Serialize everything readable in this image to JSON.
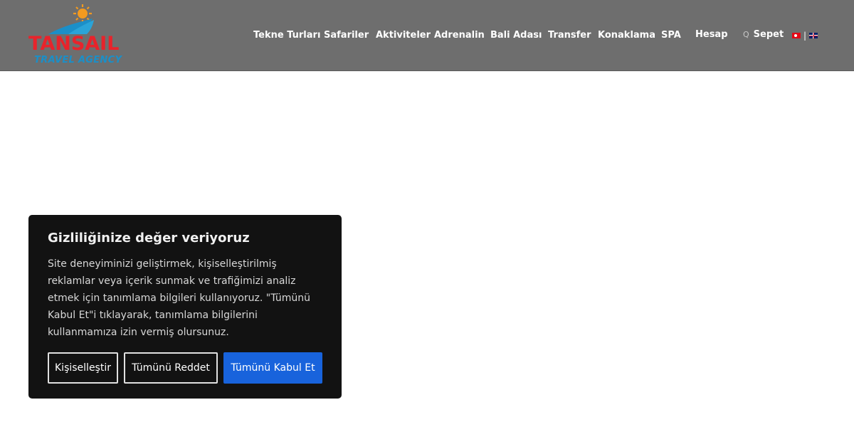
{
  "brand": {
    "name": "TANSAIL",
    "tagline": "TRAVEL AGENCY",
    "colors": {
      "red": "#e8232b",
      "blue": "#1b8fc8",
      "orange": "#f39a1f"
    }
  },
  "nav": {
    "items": [
      {
        "label": "Tekne Turları"
      },
      {
        "label": "Safariler"
      },
      {
        "label": "Aktiviteler"
      },
      {
        "label": "Adrenalin"
      },
      {
        "label": "Bali Adası"
      },
      {
        "label": "Transfer"
      },
      {
        "label": "Konaklama"
      },
      {
        "label": "SPA"
      }
    ],
    "account": {
      "label": "Hesap",
      "icon": "user-icon",
      "glyph": ""
    },
    "cart": {
      "label": "Sepet",
      "icon": "cart-icon",
      "glyph": "Q"
    },
    "lang_separator": "|",
    "languages": [
      {
        "code": "tr",
        "icon": "turkey-flag-icon"
      },
      {
        "code": "en",
        "icon": "uk-flag-icon"
      }
    ]
  },
  "cookie": {
    "title": "Gizliliğinize değer veriyoruz",
    "text": "Site deneyiminizi geliştirmek, kişiselleştirilmiş reklamlar veya içerik sunmak ve trafiğimizi analiz etmek için tanımlama bilgileri kullanıyoruz. \"Tümünü Kabul Et\"i tıklayarak, tanımlama bilgilerini kullanmamıza izin vermiş olursunuz.",
    "customize_label": "Kişiselleştir",
    "reject_label": "Tümünü Reddet",
    "accept_label": "Tümünü Kabul Et",
    "colors": {
      "background": "#121212",
      "accent": "#1863dc"
    }
  },
  "header": {
    "background": "#6e6e6e"
  }
}
